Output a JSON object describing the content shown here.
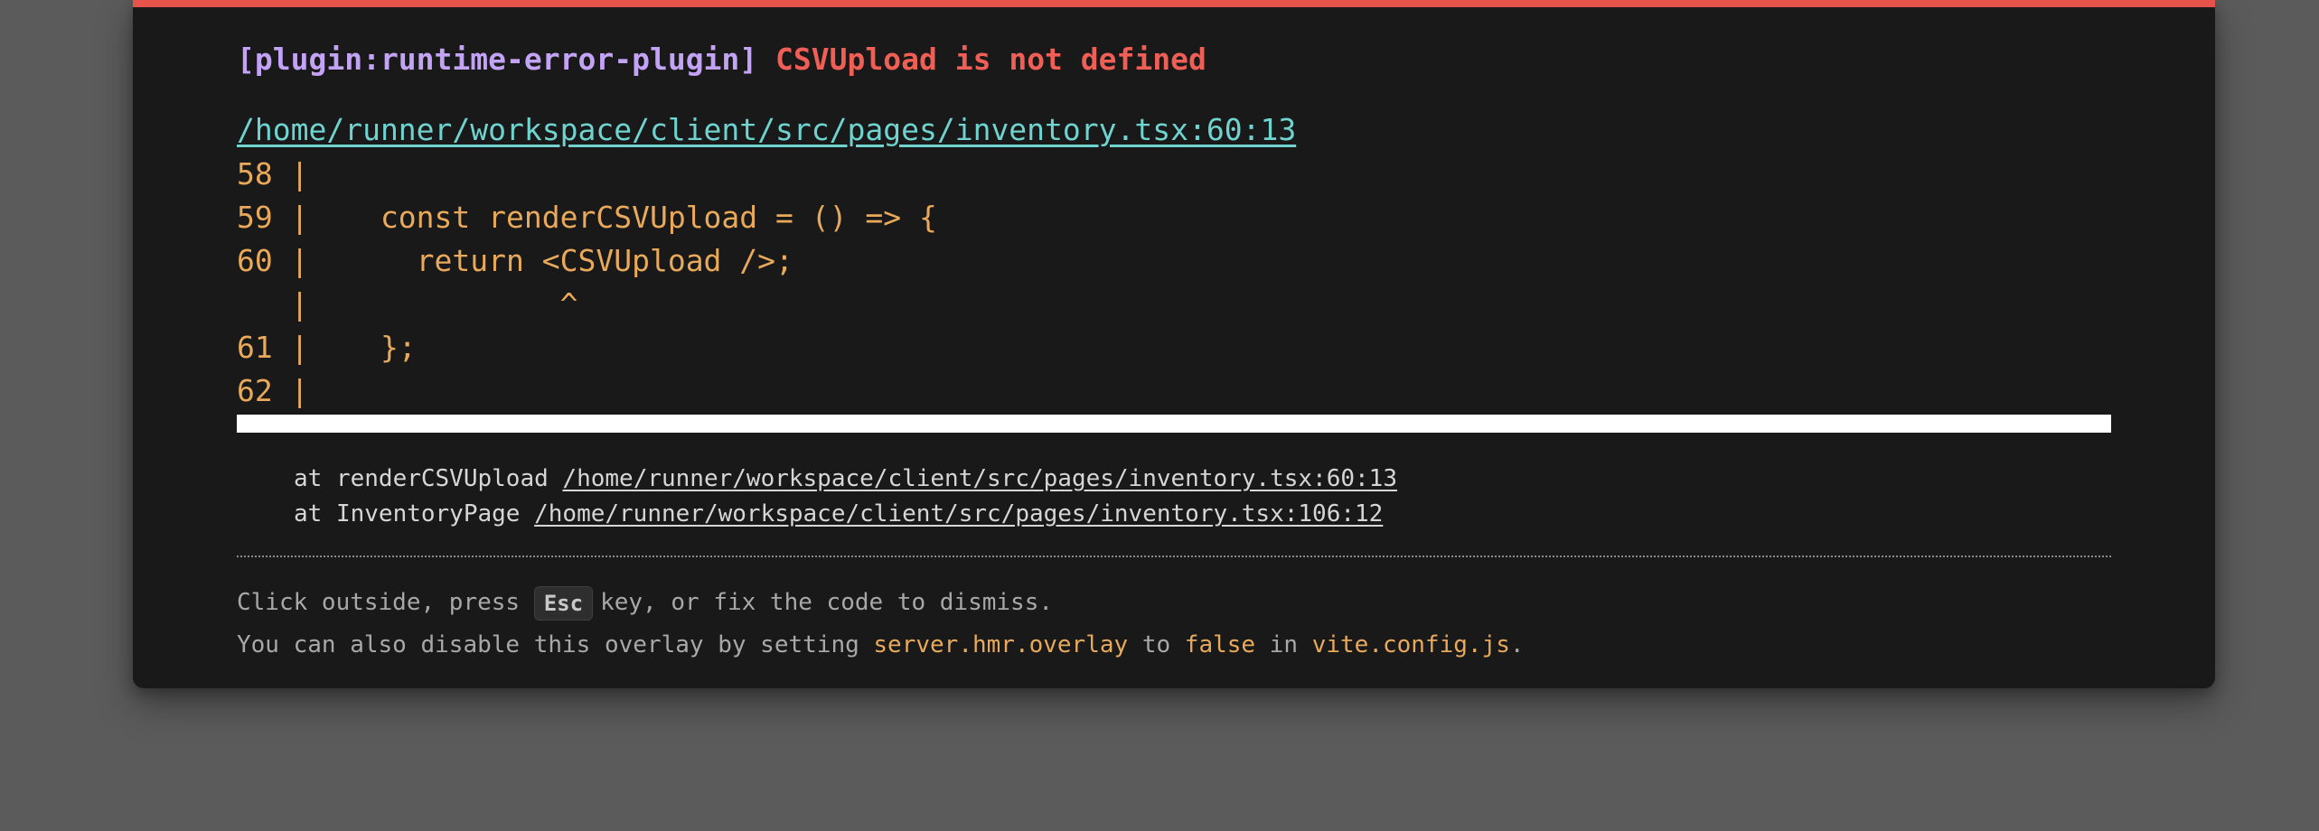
{
  "error": {
    "plugin": "[plugin:runtime-error-plugin]",
    "message": "CSVUpload is not defined",
    "file": "/home/runner/workspace/client/src/pages/inventory.tsx:60:13"
  },
  "code_frame": [
    "58 |",
    "59 |    const renderCSVUpload = () => {",
    "60 |      return <CSVUpload />;",
    "   |              ^",
    "61 |    };",
    "62 |"
  ],
  "stack": [
    {
      "prefix": "at renderCSVUpload",
      "link": "/home/runner/workspace/client/src/pages/inventory.tsx:60:13"
    },
    {
      "prefix": "at InventoryPage",
      "link": "/home/runner/workspace/client/src/pages/inventory.tsx:106:12"
    }
  ],
  "tip": {
    "line1_before": "Click outside, press ",
    "key": "Esc",
    "line1_after": "key, or fix the code to dismiss.",
    "line2_a": "You can also disable this overlay by setting ",
    "line2_code1": "server.hmr.overlay",
    "line2_b": " to ",
    "line2_code2": "false",
    "line2_c": " in ",
    "line2_code3": "vite.config.js",
    "line2_d": "."
  },
  "colors": {
    "accent_border": "#e5534b",
    "plugin": "#c3a3f5",
    "error": "#ef5f55",
    "file_link": "#6fd3cf",
    "code": "#e8a95b",
    "overlay_bg": "#191919",
    "backdrop": "#5b5b5b"
  }
}
